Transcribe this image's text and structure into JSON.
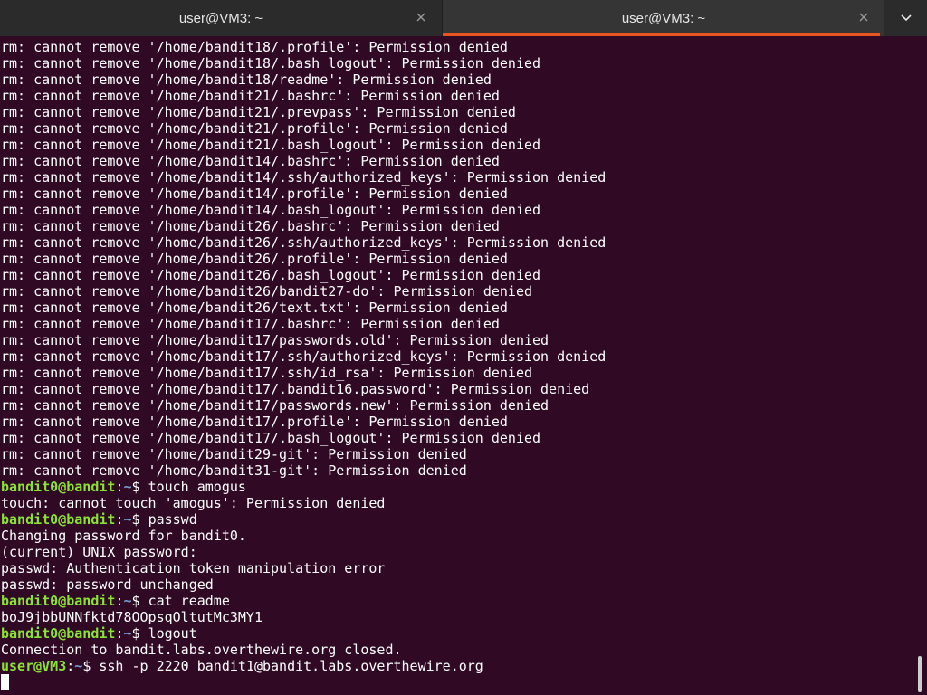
{
  "tabs": [
    {
      "title": "user@VM3: ~",
      "active": false
    },
    {
      "title": "user@VM3: ~",
      "active": true
    }
  ],
  "icons": {
    "close": "close-icon",
    "menu": "chevron-down-icon"
  },
  "colors": {
    "background": "#300a24",
    "prompt_user": "#8ae234",
    "prompt_path": "#729fcf",
    "accent": "#e95420"
  },
  "terminal": {
    "error_lines": [
      "rm: cannot remove '/home/bandit18/.profile': Permission denied",
      "rm: cannot remove '/home/bandit18/.bash_logout': Permission denied",
      "rm: cannot remove '/home/bandit18/readme': Permission denied",
      "rm: cannot remove '/home/bandit21/.bashrc': Permission denied",
      "rm: cannot remove '/home/bandit21/.prevpass': Permission denied",
      "rm: cannot remove '/home/bandit21/.profile': Permission denied",
      "rm: cannot remove '/home/bandit21/.bash_logout': Permission denied",
      "rm: cannot remove '/home/bandit14/.bashrc': Permission denied",
      "rm: cannot remove '/home/bandit14/.ssh/authorized_keys': Permission denied",
      "rm: cannot remove '/home/bandit14/.profile': Permission denied",
      "rm: cannot remove '/home/bandit14/.bash_logout': Permission denied",
      "rm: cannot remove '/home/bandit26/.bashrc': Permission denied",
      "rm: cannot remove '/home/bandit26/.ssh/authorized_keys': Permission denied",
      "rm: cannot remove '/home/bandit26/.profile': Permission denied",
      "rm: cannot remove '/home/bandit26/.bash_logout': Permission denied",
      "rm: cannot remove '/home/bandit26/bandit27-do': Permission denied",
      "rm: cannot remove '/home/bandit26/text.txt': Permission denied",
      "rm: cannot remove '/home/bandit17/.bashrc': Permission denied",
      "rm: cannot remove '/home/bandit17/passwords.old': Permission denied",
      "rm: cannot remove '/home/bandit17/.ssh/authorized_keys': Permission denied",
      "rm: cannot remove '/home/bandit17/.ssh/id_rsa': Permission denied",
      "rm: cannot remove '/home/bandit17/.bandit16.password': Permission denied",
      "rm: cannot remove '/home/bandit17/passwords.new': Permission denied",
      "rm: cannot remove '/home/bandit17/.profile': Permission denied",
      "rm: cannot remove '/home/bandit17/.bash_logout': Permission denied",
      "rm: cannot remove '/home/bandit29-git': Permission denied",
      "rm: cannot remove '/home/bandit31-git': Permission denied"
    ],
    "session": [
      {
        "type": "prompt",
        "user": "bandit0@bandit",
        "path": "~",
        "cmd": "touch amogus"
      },
      {
        "type": "output",
        "text": "touch: cannot touch 'amogus': Permission denied"
      },
      {
        "type": "prompt",
        "user": "bandit0@bandit",
        "path": "~",
        "cmd": "passwd"
      },
      {
        "type": "output",
        "text": "Changing password for bandit0."
      },
      {
        "type": "output",
        "text": "(current) UNIX password:"
      },
      {
        "type": "output",
        "text": "passwd: Authentication token manipulation error"
      },
      {
        "type": "output",
        "text": "passwd: password unchanged"
      },
      {
        "type": "prompt",
        "user": "bandit0@bandit",
        "path": "~",
        "cmd": "cat readme"
      },
      {
        "type": "output",
        "text": "boJ9jbbUNNfktd78OOpsqOltutMc3MY1"
      },
      {
        "type": "prompt",
        "user": "bandit0@bandit",
        "path": "~",
        "cmd": "logout"
      },
      {
        "type": "output",
        "text": "Connection to bandit.labs.overthewire.org closed."
      },
      {
        "type": "prompt",
        "user": "user@VM3",
        "path": "~",
        "cmd": "ssh -p 2220 bandit1@bandit.labs.overthewire.org"
      }
    ]
  }
}
